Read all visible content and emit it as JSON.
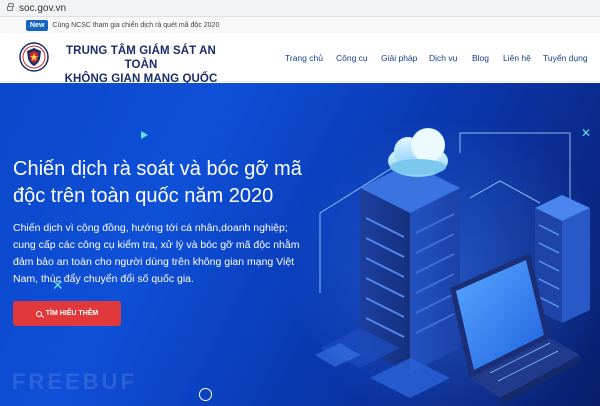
{
  "browser": {
    "url": "soc.gov.vn"
  },
  "announcement": {
    "badge": "New",
    "text": "Cùng NCSC tham gia chiến dịch rà quét mã độc 2020"
  },
  "header": {
    "org_line1": "TRUNG TÂM GIÁM SÁT AN TOÀN",
    "org_line2": "KHÔNG GIAN MẠNG QUỐC GIA",
    "logo_icon": "ncsc-shield-logo"
  },
  "nav": [
    {
      "label": "Trang chủ"
    },
    {
      "label": "Công cụ"
    },
    {
      "label": "Giải pháp"
    },
    {
      "label": "Dịch vụ"
    },
    {
      "label": "Blog"
    },
    {
      "label": "Liên hệ"
    },
    {
      "label": "Tuyển dụng"
    }
  ],
  "hero": {
    "title_line1": "Chiến dịch rà soát và bóc gỡ mã",
    "title_line2": "độc trên toàn quốc năm 2020",
    "desc_line1": "Chiến dịch vì cộng đồng, hướng tới cá nhân,doanh nghiệp;",
    "desc_line2": "cung cấp các công cụ kiểm tra, xử lý và bóc gỡ mã độc nhằm",
    "desc_line3": "đảm bảo an toàn cho người dùng trên không gian mạng Việt",
    "desc_line4": "Nam, thúc đẩy chuyển đổi số quốc gia.",
    "cta_label": "TÌM HIỂU THÊM",
    "cta_icon": "search-icon",
    "watermark": "FREEBUF"
  },
  "colors": {
    "brand_navy": "#1a2d6b",
    "nav_blue": "#1a3c8f",
    "hero_blue": "#0b47c9",
    "cta_red": "#e0383b",
    "accent_cyan": "#5fe0e6"
  }
}
